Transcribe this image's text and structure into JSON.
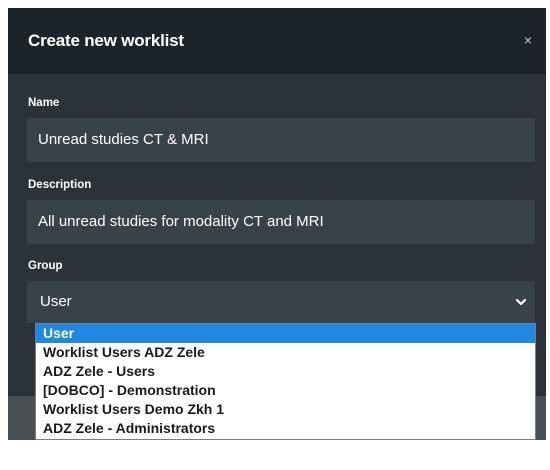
{
  "dialog": {
    "title": "Create new worklist",
    "close_symbol": "×"
  },
  "form": {
    "name_label": "Name",
    "name_value": "Unread studies CT & MRI",
    "description_label": "Description",
    "description_value": "All unread studies for modality CT and MRI",
    "group_label": "Group",
    "group_value": "User"
  },
  "dropdown": {
    "options": [
      {
        "label": "User",
        "selected": true
      },
      {
        "label": "Worklist Users ADZ Zele",
        "selected": false
      },
      {
        "label": "ADZ Zele - Users",
        "selected": false
      },
      {
        "label": "[DOBCO] - Demonstration",
        "selected": false
      },
      {
        "label": "Worklist Users Demo Zkh 1",
        "selected": false
      },
      {
        "label": "ADZ Zele - Administrators",
        "selected": false
      }
    ]
  },
  "colors": {
    "header_bg": "#1d2429",
    "body_bg": "#2c3338",
    "field_bg": "#3a4249",
    "selected_option": "#1e88e5"
  },
  "icons": {
    "close": "close-icon",
    "dropdown": "chevron-down-icon"
  }
}
